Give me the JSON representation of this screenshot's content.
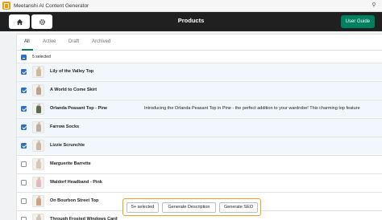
{
  "window": {
    "title": "Meetanshi AI Content Generator"
  },
  "header": {
    "title": "Products",
    "user_guide_label": "User Guide"
  },
  "tabs": [
    {
      "label": "All",
      "active": true
    },
    {
      "label": "Active",
      "active": false
    },
    {
      "label": "Draft",
      "active": false
    },
    {
      "label": "Archived",
      "active": false
    }
  ],
  "bulk": {
    "selected_text": "5 selected"
  },
  "products": [
    {
      "name": "Lily of the Valley Top",
      "selected": true,
      "description": ""
    },
    {
      "name": "A World to Come Skirt",
      "selected": true,
      "description": ""
    },
    {
      "name": "Orlanda Peasant Top - Pine",
      "selected": true,
      "description": "Introducing the Orlanda Peasant Top in Pine - the perfect addition to your wardrobe! This charming top feature"
    },
    {
      "name": "Farrow Socks",
      "selected": true,
      "description": ""
    },
    {
      "name": "Lizzie Scrunchie",
      "selected": true,
      "description": ""
    },
    {
      "name": "Marguerite Barrette",
      "selected": false,
      "description": ""
    },
    {
      "name": "Waldorf Headband - Pink",
      "selected": false,
      "description": ""
    },
    {
      "name": "On Bourbon Street Top",
      "selected": false,
      "description": ""
    },
    {
      "name": "Through Frosted Windows Card",
      "selected": false,
      "description": ""
    }
  ],
  "actions": {
    "selected_label": "5+ selected",
    "generate_description_label": "Generate Description",
    "generate_seo_label": "Generate SEO"
  },
  "colors": {
    "accent": "#008060",
    "checkbox": "#2c6ecb",
    "highlight": "#f39c1e"
  }
}
